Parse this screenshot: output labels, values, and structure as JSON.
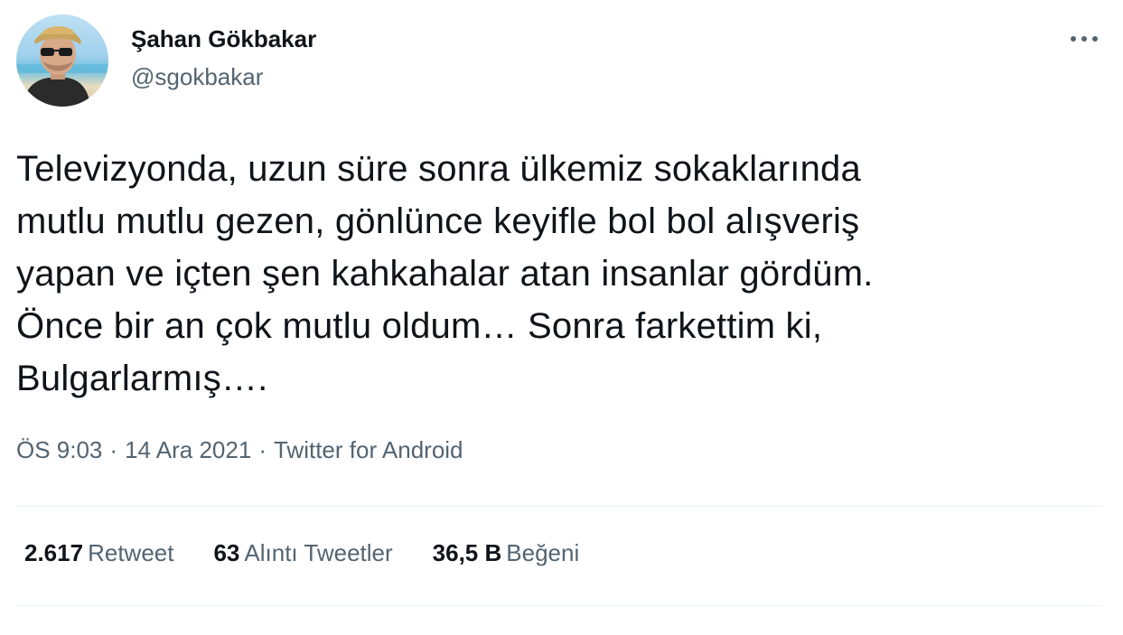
{
  "author": {
    "name": "Şahan Gökbakar",
    "handle": "@sgokbakar",
    "avatar_icon": "profile-photo"
  },
  "more_icon": "ellipsis-icon",
  "tweet": {
    "text": "Televizyonda, uzun süre sonra ülkemiz sokaklarında\nmutlu mutlu gezen, gönlünce keyifle bol bol alışveriş\nyapan ve içten şen kahkahalar atan insanlar gördüm.\nÖnce bir an çok mutlu oldum… Sonra farkettim ki,\nBulgarlarmış…."
  },
  "meta": {
    "time": "ÖS 9:03",
    "date": "14 Ara 2021",
    "source": "Twitter for Android",
    "separator": "·"
  },
  "stats": {
    "retweets": {
      "count": "2.617",
      "label": "Retweet"
    },
    "quotes": {
      "count": "63",
      "label": "Alıntı Tweetler"
    },
    "likes": {
      "count": "36,5 B",
      "label": "Beğeni"
    }
  },
  "colors": {
    "text_primary": "#0f1419",
    "text_secondary": "#536471",
    "divider": "#eff3f4"
  }
}
